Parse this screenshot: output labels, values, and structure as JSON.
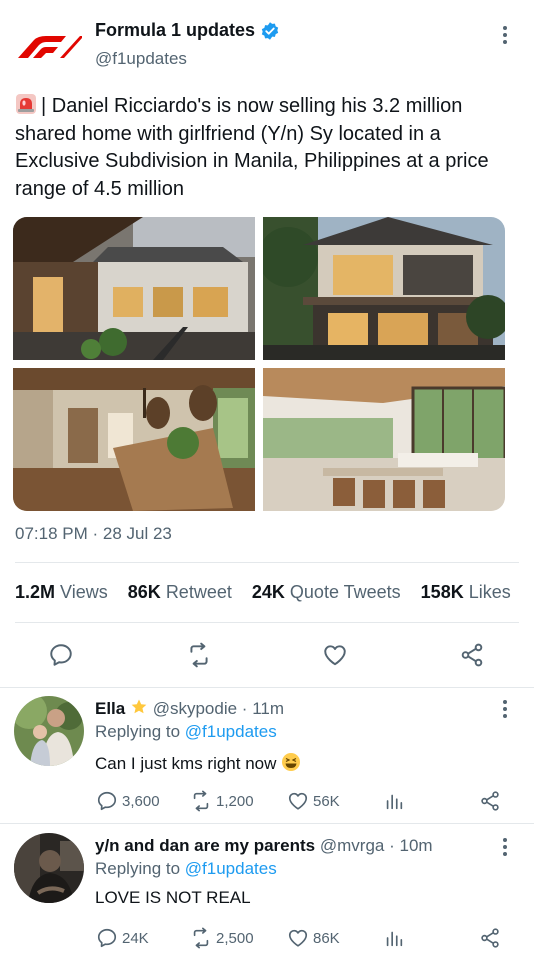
{
  "tweet": {
    "author_name": "Formula 1 updates",
    "author_handle": "@f1updates",
    "text_icon": "police-light-icon",
    "text": "| Daniel Ricciardo's is now selling his 3.2 million shared home with girlfriend (Y/n) Sy located in a Exclusive Subdivision in Manila, Philippines at a price range of 4.5 million",
    "timestamp": "07:18 PM · 28 Jul 23",
    "stats": {
      "views_count": "1.2M",
      "views_label": "Views",
      "retweets_count": "86K",
      "retweets_label": "Retweet",
      "quotes_count": "24K",
      "quotes_label": "Quote Tweets",
      "likes_count": "158K",
      "likes_label": "Likes"
    },
    "photos": [
      "house-exterior-balcony",
      "house-exterior-two-story",
      "interior-hallway-staircase",
      "interior-living-dining-room"
    ]
  },
  "replies": [
    {
      "name": "Ella",
      "badge_icon": "star-emoji-icon",
      "handle": "@skypodie",
      "time": "11m",
      "replying_prefix": "Replying to",
      "replying_handle": "@f1updates",
      "text": "Can I just kms right now",
      "text_emoji": "grinning-squinting-face-icon",
      "replies": "3,600",
      "retweets": "1,200",
      "likes": "56K"
    },
    {
      "name": "y/n and dan are my parents",
      "handle": "@mvrga",
      "time": "10m",
      "replying_prefix": "Replying to",
      "replying_handle": "@f1updates",
      "text": "LOVE IS NOT REAL",
      "replies": "24K",
      "retweets": "2,500",
      "likes": "86K"
    }
  ],
  "colors": {
    "accent": "#1d9bf0",
    "muted": "#536471",
    "f1_red": "#e10600",
    "text": "#0f1419"
  }
}
